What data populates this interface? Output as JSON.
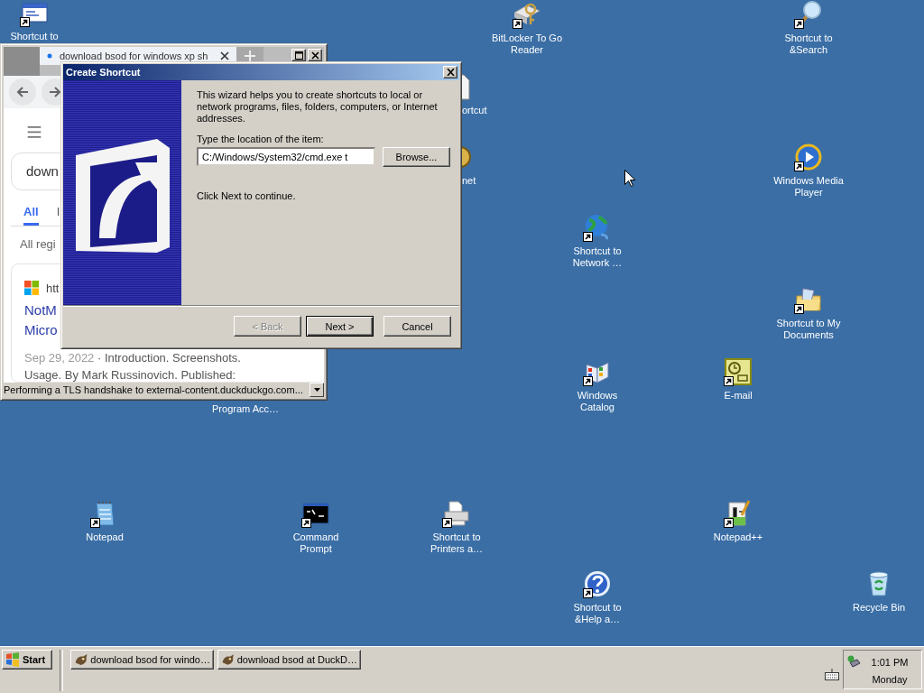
{
  "desktop": {
    "icons": [
      {
        "label": "Shortcut to",
        "kind": "window",
        "shortcut": true
      },
      {
        "label": "BitLocker To Go Reader",
        "kind": "bitlocker",
        "shortcut": true
      },
      {
        "label": "Shortcut to &Search",
        "kind": "search",
        "shortcut": true
      },
      {
        "label": "ortcut",
        "kind": "document",
        "shortcut": false
      },
      {
        "label": "net",
        "kind": "emblem",
        "shortcut": false
      },
      {
        "label": "Windows Media Player",
        "kind": "media",
        "shortcut": true
      },
      {
        "label": "Shortcut to Network …",
        "kind": "globe",
        "shortcut": true
      },
      {
        "label": "Shortcut to My Documents",
        "kind": "folder",
        "shortcut": true
      },
      {
        "label": "Windows Catalog",
        "kind": "catalog",
        "shortcut": true
      },
      {
        "label": "E-mail",
        "kind": "email",
        "shortcut": true
      },
      {
        "label": "Program Acc…",
        "kind": "hidden",
        "shortcut": false
      },
      {
        "label": "Notepad",
        "kind": "notepad",
        "shortcut": true
      },
      {
        "label": "Command Prompt",
        "kind": "console",
        "shortcut": true
      },
      {
        "label": "Shortcut to Printers a…",
        "kind": "printer",
        "shortcut": true
      },
      {
        "label": "Notepad++",
        "kind": "notepadpp",
        "shortcut": true
      },
      {
        "label": "Shortcut to &Help a…",
        "kind": "help",
        "shortcut": true
      },
      {
        "label": "Recycle Bin",
        "kind": "recycle",
        "shortcut": false
      }
    ]
  },
  "browser": {
    "tab_title": "download bsod for windows xp sh",
    "search_value": "down",
    "filters": [
      {
        "label": "All",
        "selected": true
      },
      {
        "label": "I",
        "selected": false
      }
    ],
    "region": "All regi",
    "result": {
      "site": "htt",
      "title": [
        "NotM",
        "Micro"
      ],
      "date": "Sep 29, 2022",
      "snippet": [
        "· Introduction. Screenshots.",
        "Usage. By Mark Russinovich. Published:"
      ]
    },
    "status": "Performing a TLS handshake to external-content.duckduckgo.com..."
  },
  "dialog": {
    "title": "Create Shortcut",
    "intro": "This wizard helps you to create shortcuts to local or network programs, files, folders, computers, or Internet addresses.",
    "field_label": "Type the location of the item:",
    "location": "C:/Windows/System32/cmd.exe t",
    "browse": "Browse...",
    "hint": "Click Next to continue.",
    "buttons": [
      {
        "label": "< Back",
        "disabled": true,
        "default": false
      },
      {
        "label": "Next >",
        "disabled": false,
        "default": true
      },
      {
        "label": "Cancel",
        "disabled": false,
        "default": false
      }
    ]
  },
  "taskbar": {
    "start": "Start",
    "tasks": [
      {
        "label": "download bsod for windo…",
        "selected": false
      },
      {
        "label": "download bsod at DuckD…",
        "selected": false
      }
    ],
    "time": "1:01 PM",
    "day": "Monday"
  }
}
